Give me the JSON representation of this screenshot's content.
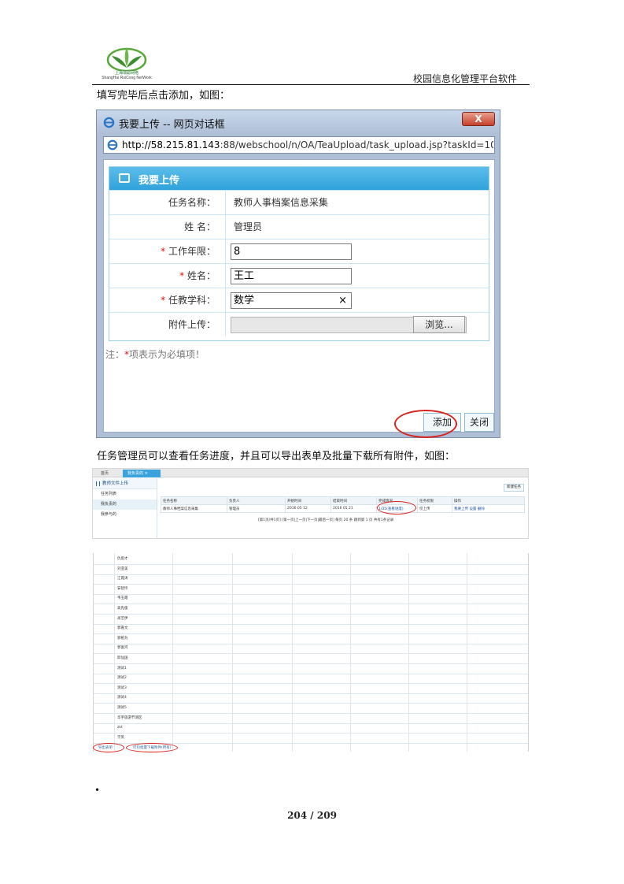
{
  "header": {
    "logo_name": "上海瑞聪网络",
    "logo_en": "ShangHai RuiCong NetWork",
    "title": "校园信息化管理平台软件"
  },
  "captions": {
    "first": "填写完毕后点击添加，如图：",
    "second": "任务管理员可以查看任务进度，并且可以导出表单及批量下载所有附件，如图："
  },
  "dialog": {
    "window_title": "我要上传 -- 网页对话框",
    "close_label": "X",
    "url_host": "http://58.215.81.143",
    "url_rest": ":88/webschool/n/OA/TeaUpload/task_upload.jsp?taskId=100",
    "panel_title": "我要上传",
    "fields": [
      {
        "label": "任务名称：",
        "required": false,
        "value": "教师人事档案信息采集",
        "type": "text"
      },
      {
        "label": "姓  名：",
        "required": false,
        "value": "管理员",
        "type": "text"
      },
      {
        "label": "工作年限：",
        "required": true,
        "value": "8",
        "type": "input"
      },
      {
        "label": "姓名：",
        "required": true,
        "value": "王工",
        "type": "input"
      },
      {
        "label": "任教学科：",
        "required": true,
        "value": "数学",
        "type": "input-clear"
      },
      {
        "label": "附件上传：",
        "required": false,
        "value": "",
        "type": "file"
      }
    ],
    "required_mark": "*",
    "browse_label": "浏览...",
    "note_prefix": "注：",
    "note_star": "*",
    "note_text": "项表示为必填项！",
    "add_label": "添加",
    "close_button_label": "关闭",
    "clear_icon": "×"
  },
  "list_shot": {
    "tabs": [
      "首页",
      "我负责的"
    ],
    "tab_close": "×",
    "sidebar_title": "教师文件上传",
    "sidebar_items": [
      "任务列表",
      "我负责的",
      "我参与的"
    ],
    "new_button": "新建任务",
    "columns": [
      "任务名称",
      "负责人",
      "开始时间",
      "结束时间",
      "完成情况",
      "任务权限",
      "操作"
    ],
    "rows": [
      {
        "name": "教师人事档案信息采集",
        "owner": "管理员",
        "start": "2016 05 12",
        "end": "2016 05 21",
        "progress": "1/35(查看进度)",
        "perm": "仅上传",
        "ops": [
          "我要上传",
          "设置",
          "删除"
        ]
      }
    ],
    "pager": "[第1页/共1页] [第一页|上一页|下一页|最后一页] 每页 20 条 跳到第 1 页 共有1条记录"
  },
  "name_shot": {
    "names": [
      "仇思才",
      "刘亚美",
      "江霞涛",
      "安智玲",
      "韦玉霞",
      "高先俊",
      "高艺伊",
      "郭嘉文",
      "郭拓为",
      "郭富河",
      "邱仙国",
      "测试1",
      "测试2",
      "测试3",
      "测试4",
      "测试5",
      "华宇旅游节测区",
      "zkt",
      "学英"
    ],
    "bottom_buttons": [
      "导出表单",
      "打包批量下载附件(所有)"
    ]
  },
  "footer": {
    "bullet": "•",
    "page": "204 / 209"
  }
}
